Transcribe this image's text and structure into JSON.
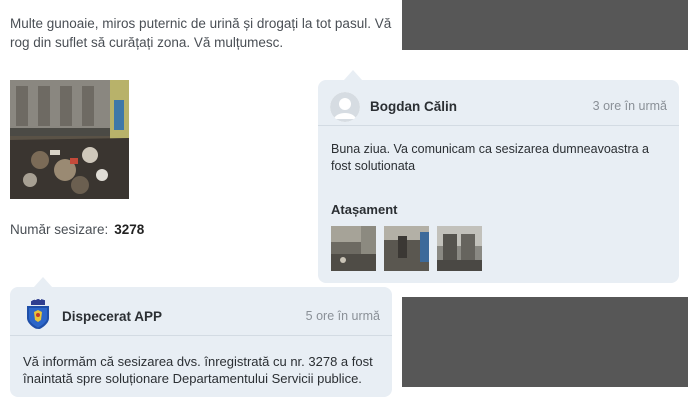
{
  "report": {
    "description": "Multe gunoaie, miros puternic de urină și drogați la tot pasul. Vă rog din suflet să curățați zona. Vă mulțumesc.",
    "number_label": "Număr sesizare:",
    "number_value": "3278"
  },
  "replies": [
    {
      "author": "Bogdan Călin",
      "time": "3 ore în urmă",
      "message": "Buna ziua. Va comunicam ca sesizarea dumneavoastra a fost solutionata",
      "attachments_title": "Atașament",
      "attachments": [
        "photo-1",
        "photo-2",
        "photo-3"
      ]
    },
    {
      "author": "Dispecerat APP",
      "time": "5 ore în urmă",
      "message": "Vă informăm că sesizarea dvs. înregistrată cu nr. 3278 a fost înaintată spre soluționare Departamentului Servicii publice."
    }
  ],
  "colors": {
    "card_bg": "#e8eef4",
    "side_bg": "#575757"
  }
}
